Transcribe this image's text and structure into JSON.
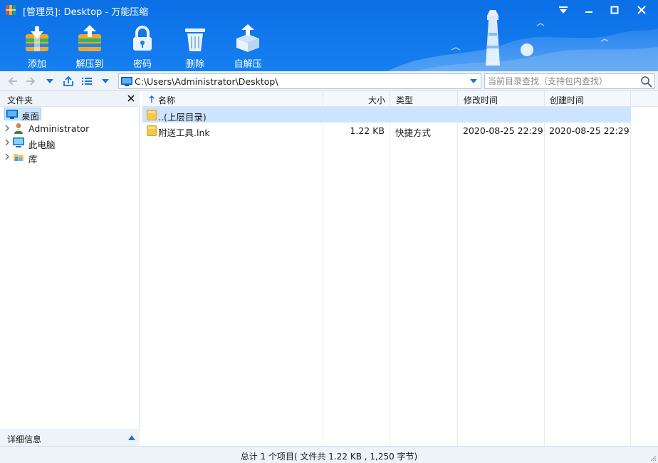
{
  "window": {
    "title": "[管理员]: Desktop - 万能压缩",
    "controls": [
      "menu-dropdown",
      "minimize",
      "maximize",
      "close"
    ]
  },
  "toolbar": {
    "buttons": [
      {
        "label": "添加",
        "icon": "add-archive-icon"
      },
      {
        "label": "解压到",
        "icon": "extract-icon"
      },
      {
        "label": "密码",
        "icon": "lock-icon"
      },
      {
        "label": "删除",
        "icon": "trash-icon"
      },
      {
        "label": "自解压",
        "icon": "self-extract-box-icon"
      }
    ]
  },
  "addressbar": {
    "path": "C:\\Users\\Administrator\\Desktop\\",
    "search_placeholder": "当前目录查找（支持包内查找）"
  },
  "leftpane": {
    "header": "文件夹",
    "items": [
      {
        "label": "桌面",
        "icon": "desktop-icon",
        "selected": true,
        "expandable": false
      },
      {
        "label": "Administrator",
        "icon": "user-icon",
        "selected": false,
        "expandable": true
      },
      {
        "label": "此电脑",
        "icon": "computer-icon",
        "selected": false,
        "expandable": true
      },
      {
        "label": "库",
        "icon": "library-icon",
        "selected": false,
        "expandable": true
      }
    ],
    "details_label": "详细信息"
  },
  "filelist": {
    "columns": {
      "name": "名称",
      "size": "大小",
      "type": "类型",
      "modified": "修改时间",
      "created": "创建时间"
    },
    "sort_column": "name",
    "rows": [
      {
        "name": "..(上层目录)",
        "size": "",
        "type": "",
        "modified": "",
        "created": "",
        "selected": true
      },
      {
        "name": "附送工具.lnk",
        "size": "1.22 KB",
        "type": "快捷方式",
        "modified": "2020-08-25 22:29",
        "created": "2020-08-25 22:29",
        "selected": false
      }
    ]
  },
  "status": {
    "text": "总计 1 个项目( 文件共 1.22 KB , 1,250 字节)"
  },
  "colors": {
    "header_blue": "#0b6fe6",
    "selection": "#cce4ff",
    "folder_yellow": "#f5c84c",
    "accent": "#1a73d9"
  }
}
